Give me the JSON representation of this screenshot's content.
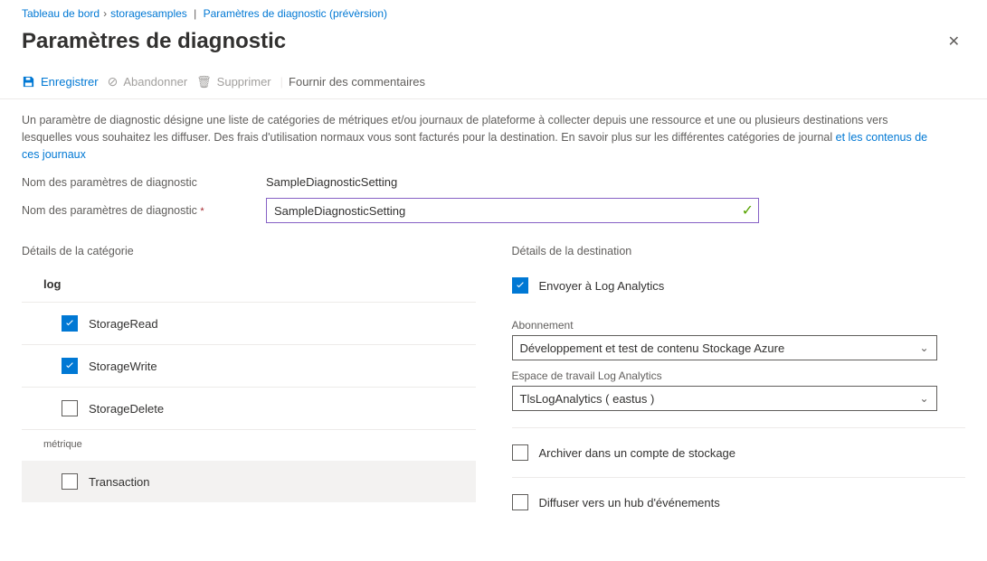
{
  "breadcrumb": {
    "dashboard": "Tableau de bord",
    "resource": "storagesamples",
    "page": "Paramètres de diagnostic (prévèrsion)"
  },
  "header": {
    "title": "Paramètres de diagnostic"
  },
  "toolbar": {
    "save": "Enregistrer",
    "discard": "Abandonner",
    "delete": "Supprimer",
    "feedback": "Fournir des commentaires"
  },
  "description": {
    "text1": "Un paramètre de diagnostic désigne une liste de catégories de métriques et/ou journaux de plateforme à collecter depuis une ressource et une ou plusieurs destinations vers lesquelles vous souhaitez les diffuser. Des frais d'utilisation normaux vous sont facturés pour la destination. En savoir plus sur les différentes catégories de journal ",
    "link": "et les contenus de ces journaux"
  },
  "form": {
    "label": "Nom des paramètres de diagnostic",
    "staticValue": "SampleDiagnosticSetting",
    "inputValue": "SampleDiagnosticSetting"
  },
  "category": {
    "title": "Détails de la catégorie",
    "logSection": "log",
    "metricSection": "métrique",
    "items": {
      "storageRead": "StorageRead",
      "storageWrite": "StorageWrite",
      "storageDelete": "StorageDelete",
      "transaction": "Transaction"
    }
  },
  "destination": {
    "title": "Détails de la destination",
    "logAnalytics": "Envoyer à Log Analytics",
    "subscriptionLabel": "Abonnement",
    "subscriptionValue": "Développement et test de contenu Stockage Azure",
    "workspaceLabel": "Espace de travail Log Analytics",
    "workspaceValue": "TlsLogAnalytics ( eastus )",
    "archive": "Archiver dans un compte de stockage",
    "eventHub": "Diffuser vers un hub d'événements"
  }
}
